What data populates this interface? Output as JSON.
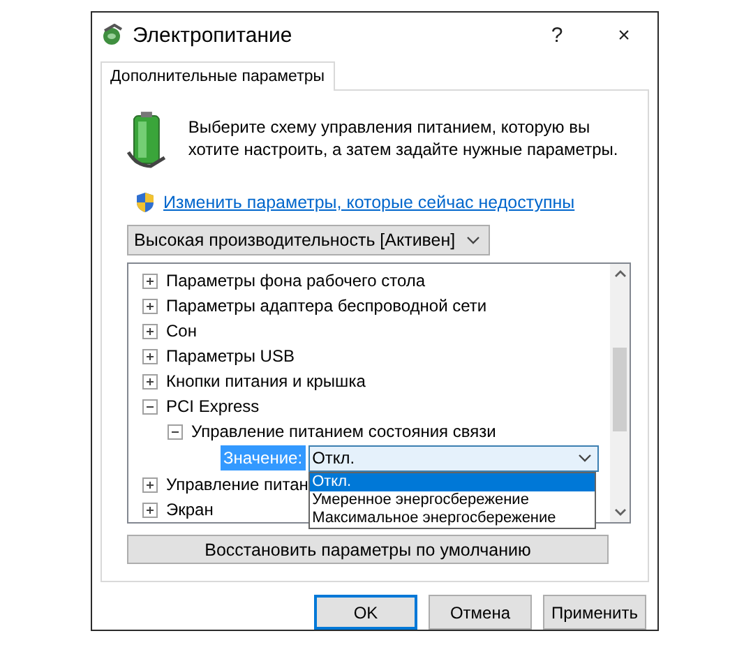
{
  "window": {
    "title": "Электропитание",
    "help": "?",
    "close": "×"
  },
  "tabs": [
    {
      "label": "Дополнительные параметры",
      "selected": true
    }
  ],
  "intro": "Выберите схему управления питанием, которую вы хотите настроить, а затем задайте нужные параметры.",
  "admin_link": "Изменить параметры, которые сейчас недоступны",
  "plan_dropdown": {
    "value": "Высокая производительность [Активен]"
  },
  "settings_tree": [
    {
      "label": "Параметры фона рабочего стола",
      "expanded": false
    },
    {
      "label": "Параметры адаптера беспроводной сети",
      "expanded": false
    },
    {
      "label": "Сон",
      "expanded": false
    },
    {
      "label": "Параметры USB",
      "expanded": false
    },
    {
      "label": "Кнопки питания и крышка",
      "expanded": false
    },
    {
      "label": "PCI Express",
      "expanded": true,
      "children": [
        {
          "label": "Управление питанием состояния связи",
          "expanded": true,
          "children": [
            {
              "kind": "setting",
              "label": "Значение:",
              "value": "Откл.",
              "open": true,
              "options": [
                {
                  "label": "Откл.",
                  "selected": true
                },
                {
                  "label": "Умеренное энергосбережение",
                  "selected": false
                },
                {
                  "label": "Максимальное энергосбережение",
                  "selected": false
                }
              ]
            }
          ]
        }
      ]
    },
    {
      "label": "Управление питан",
      "expanded": false
    },
    {
      "label": "Экран",
      "expanded": false
    }
  ],
  "restore_button": "Восстановить параметры по умолчанию",
  "buttons": [
    {
      "label": "OK",
      "default": true
    },
    {
      "label": "Отмена",
      "default": false
    },
    {
      "label": "Применить",
      "default": false
    }
  ]
}
